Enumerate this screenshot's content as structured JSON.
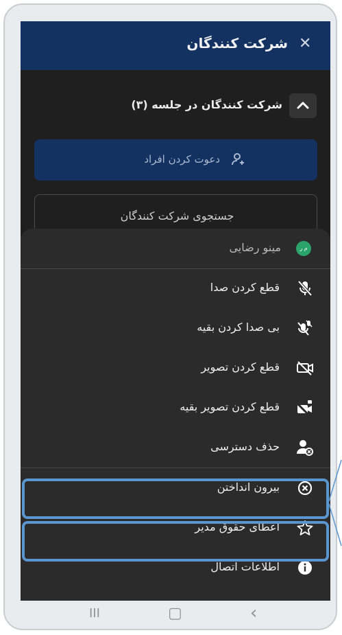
{
  "header": {
    "title": "شرکت کنندگان",
    "close_icon": "close-icon"
  },
  "participants": {
    "section_title": "شرکت کنندگان در جلسه (۳)"
  },
  "invite": {
    "label": "دعوت کردن افراد",
    "icon": "person-add-icon"
  },
  "search": {
    "placeholder": "جستجوی شرکت کنندگان",
    "value": ""
  },
  "menu": {
    "user": {
      "name": "مینو رضایی",
      "avatar_text": "م ر"
    },
    "items": [
      {
        "label": "قطع کردن صدا",
        "icon": "mic-off-icon"
      },
      {
        "label": "بی صدا کردن بقیه",
        "icon": "mic-off-all-icon"
      },
      {
        "label": "قطع کردن تصویر",
        "icon": "video-off-icon"
      },
      {
        "label": "قطع کردن تصویر بقیه",
        "icon": "video-off-all-icon"
      },
      {
        "label": "حذف دسترسی",
        "icon": "person-remove-icon"
      },
      {
        "label": "بیرون انداختن",
        "icon": "kick-out-icon"
      },
      {
        "label": "اعطای حقوق مدیر",
        "icon": "star-icon"
      },
      {
        "label": "اطلاعات اتصال",
        "icon": "info-icon"
      }
    ]
  },
  "navbar": {
    "recent": "III",
    "home": "▢",
    "back": "‹"
  },
  "colors": {
    "header_bg": "#143261",
    "panel_bg": "#1f1f1f",
    "menu_bg": "#2b2b2b",
    "highlight": "#5b95cf",
    "avatar": "#2aa46a"
  }
}
